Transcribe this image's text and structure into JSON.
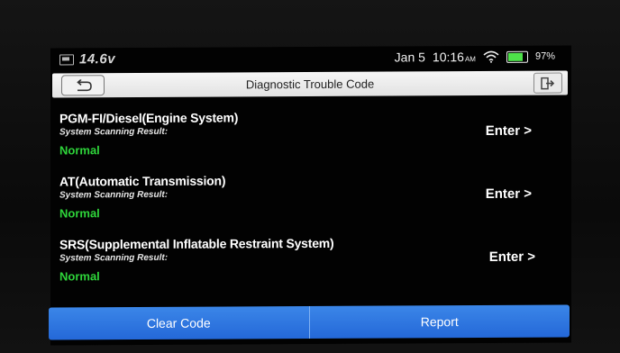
{
  "status_bar": {
    "voltage": "14.6v",
    "date": "Jan 5",
    "time": "10:16",
    "time_suffix": "AM",
    "battery_pct": "97%",
    "battery_level": 0.97,
    "battery_color": "#4ee24a"
  },
  "header": {
    "title": "Diagnostic Trouble Code",
    "back_icon": "back-arrow-icon",
    "exit_icon": "exit-icon"
  },
  "systems": [
    {
      "name": "PGM-FI/Diesel(Engine System)",
      "subtitle": "System Scanning Result:",
      "status": "Normal",
      "action": "Enter >"
    },
    {
      "name": "AT(Automatic Transmission)",
      "subtitle": "System Scanning Result:",
      "status": "Normal",
      "action": "Enter >"
    },
    {
      "name": "SRS(Supplemental Inflatable Restraint System)",
      "subtitle": "System Scanning Result:",
      "status": "Normal",
      "action": "Enter >"
    }
  ],
  "footer": {
    "clear_label": "Clear Code",
    "report_label": "Report"
  },
  "colors": {
    "accent": "#2f78e2",
    "status_normal": "#2ed43a"
  }
}
